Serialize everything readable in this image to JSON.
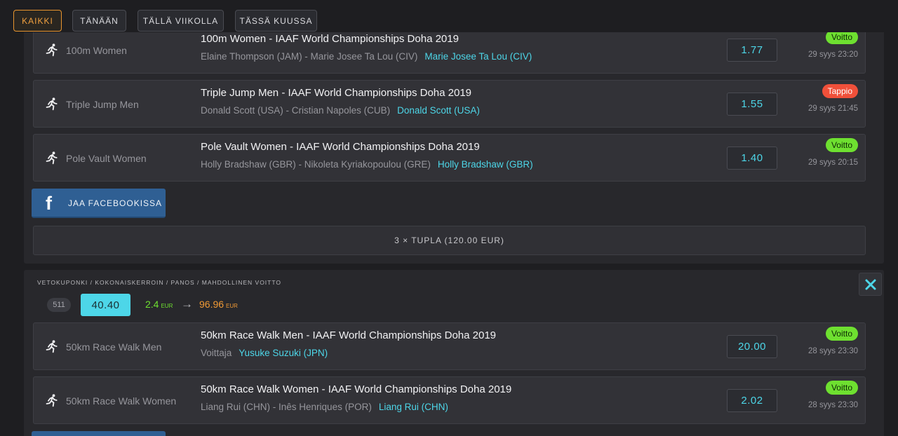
{
  "filters": [
    "KAIKKI",
    "TÄNÄÄN",
    "TÄLLÄ VIIKOLLA",
    "TÄSSÄ KUUSSA"
  ],
  "coupon1": {
    "bets": [
      {
        "sport": "100m Women",
        "title": "100m Women - IAAF World Championships Doha 2019",
        "participants": "Elaine Thompson (JAM) - Marie Josee Ta Lou (CIV)",
        "pick": "Marie Josee Ta Lou (CIV)",
        "odds": "1.77",
        "result": "Voitto",
        "date": "29 syys 23:20"
      },
      {
        "sport": "Triple Jump Men",
        "title": "Triple Jump Men - IAAF World Championships Doha 2019",
        "participants": "Donald Scott (USA) - Cristian Napoles (CUB)",
        "pick": "Donald Scott (USA)",
        "odds": "1.55",
        "result": "Tappio",
        "date": "29 syys 21:45"
      },
      {
        "sport": "Pole Vault Women",
        "title": "Pole Vault Women - IAAF World Championships Doha 2019",
        "participants": "Holly Bradshaw (GBR) - Nikoleta Kyriakopoulou (GRE)",
        "pick": "Holly Bradshaw (GBR)",
        "odds": "1.40",
        "result": "Voitto",
        "date": "29 syys 20:15"
      }
    ],
    "share_label": "JAA FACEBOOKISSA",
    "summary": "3 × TUPLA (120.00 EUR)"
  },
  "coupon2": {
    "meta": "VETOKUPONKI / KOKONAISKERROIN / PANOS / MAHDOLLINEN VOITTO",
    "id": "511",
    "total_odds": "40.40",
    "stake": "2.4",
    "stake_currency": "EUR",
    "arrow": "→",
    "payout": "96.96",
    "payout_currency": "EUR",
    "bets": [
      {
        "sport": "50km Race Walk Men",
        "title": "50km Race Walk Men - IAAF World Championships Doha 2019",
        "participants": "Voittaja",
        "pick": "Yusuke Suzuki (JPN)",
        "odds": "20.00",
        "result": "Voitto",
        "date": "28 syys 23:30"
      },
      {
        "sport": "50km Race Walk Women",
        "title": "50km Race Walk Women - IAAF World Championships Doha 2019",
        "participants": "Liang Rui (CHN) - Inês Henriques (POR)",
        "pick": "Liang Rui (CHN)",
        "odds": "2.02",
        "result": "Voitto",
        "date": "28 syys 23:30"
      }
    ]
  },
  "colors": {
    "accent_cyan": "#4dd6e8",
    "win": "#6ee030",
    "loss": "#f0503a",
    "active_filter": "#e8952f",
    "facebook": "#2f5f93"
  },
  "icons": {
    "sport": "runner-icon",
    "share": "facebook-icon",
    "close": "close-icon"
  }
}
